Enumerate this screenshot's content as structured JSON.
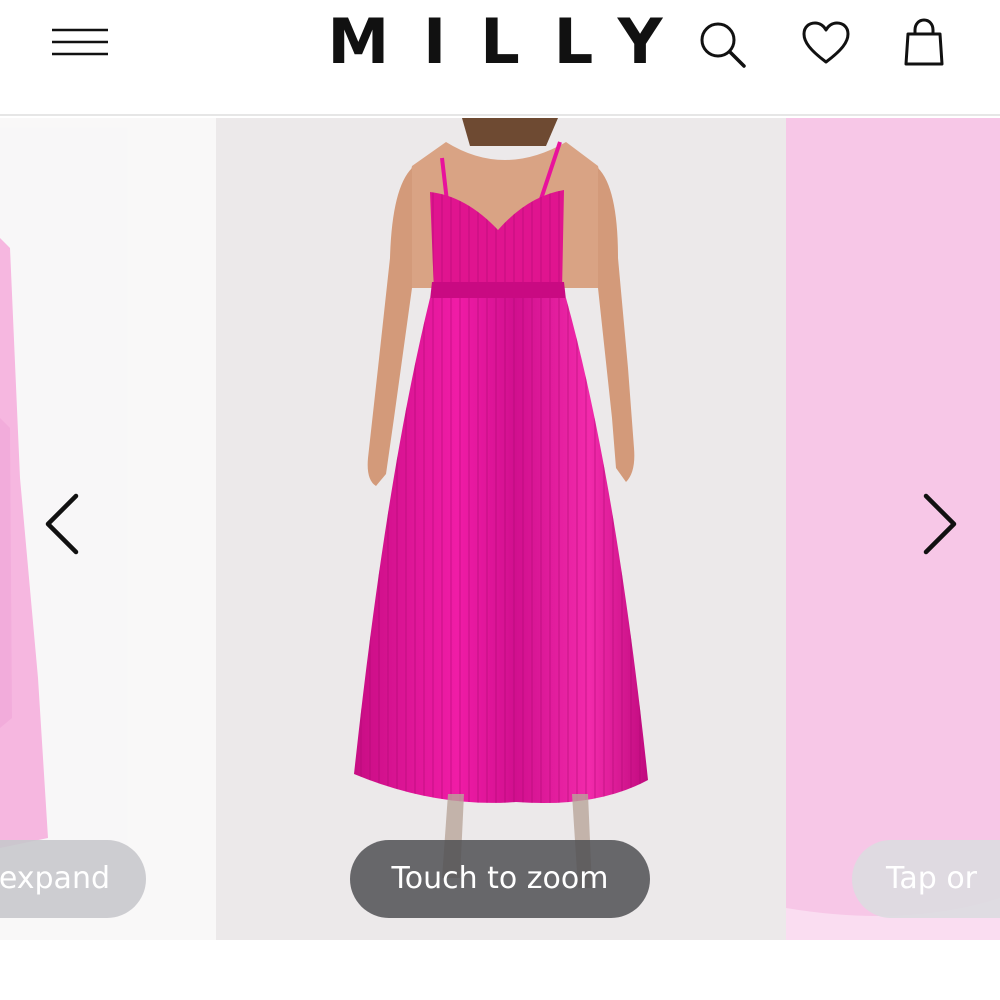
{
  "header": {
    "brand": "MILLY",
    "menu_icon": "hamburger-menu-icon",
    "search_icon": "search-icon",
    "wishlist_icon": "heart-icon",
    "bag_icon": "shopping-bag-icon"
  },
  "carousel": {
    "prev_hint": "expand",
    "current_hint": "Touch to zoom",
    "next_hint": "Tap or",
    "prev_arrow_icon": "chevron-left-icon",
    "next_arrow_icon": "chevron-right-icon"
  },
  "colors": {
    "dress_pink": "#e8139c",
    "dress_pink_faded": "#f29ad4",
    "slide_bg": "#ece9ea",
    "pill_bg": "#505054",
    "text_dark": "#111111"
  }
}
